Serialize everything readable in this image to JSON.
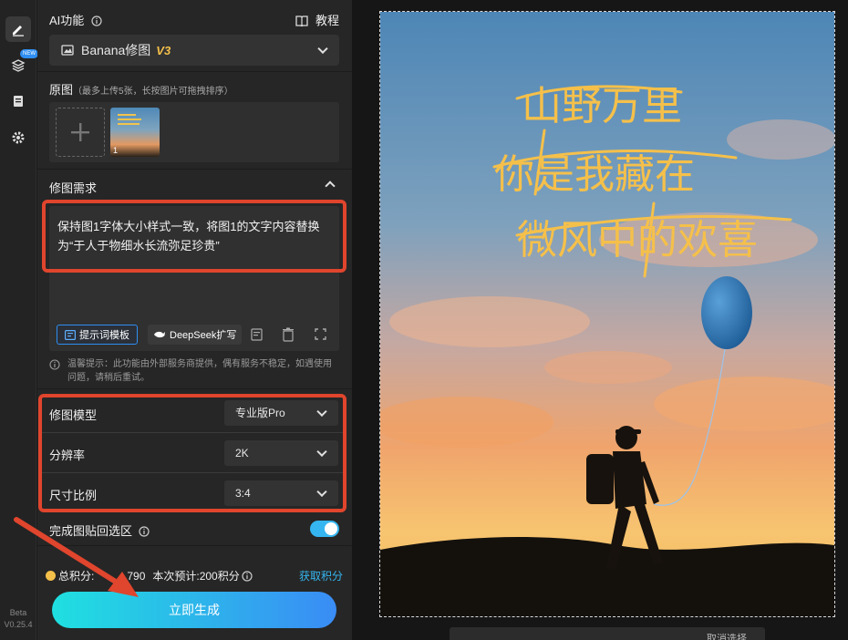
{
  "rail": {
    "new_badge": "NEW",
    "version_line1": "Beta",
    "version_line2": "V0.25.4"
  },
  "ai": {
    "title": "AI功能",
    "tutorial": "教程",
    "mode_name": "Banana修图",
    "mode_version": "V3"
  },
  "original": {
    "title": "原图",
    "hint": "（最多上传5张，长按图片可拖拽排序）",
    "thumb_index": "1"
  },
  "edit": {
    "title": "修图需求",
    "prompt_text": "保持图1字体大小样式一致，将图1的文字内容替换为“于人于物细水长流弥足珍贵”",
    "template_btn": "提示词模板",
    "deepseek_btn": "DeepSeek扩写",
    "notice": "温馨提示：此功能由外部服务商提供，偶有服务不稳定，如遇使用问题，请稍后重试。"
  },
  "settings": {
    "rows": [
      {
        "label": "修图模型",
        "value": "专业版Pro"
      },
      {
        "label": "分辨率",
        "value": "2K"
      },
      {
        "label": "尺寸比例",
        "value": "3:4"
      }
    ],
    "paste_back_label": "完成图贴回选区"
  },
  "footer": {
    "points_prefix": "总积分:",
    "points_value": "790",
    "estimate": "本次预计:200积分",
    "get_points": "获取积分",
    "generate": "立即生成"
  },
  "canvas": {
    "poem_line1": "山野万里",
    "poem_line2": "你是我藏在",
    "poem_line3": "微风中的欢喜",
    "bottom_tool_label": "取消选择"
  },
  "colors": {
    "accent_red": "#e0452d",
    "accent_blue": "#35b6f0",
    "button_gradient_start": "#1fe0e0",
    "button_gradient_end": "#3a8cf5",
    "gold": "#f5c04a"
  }
}
